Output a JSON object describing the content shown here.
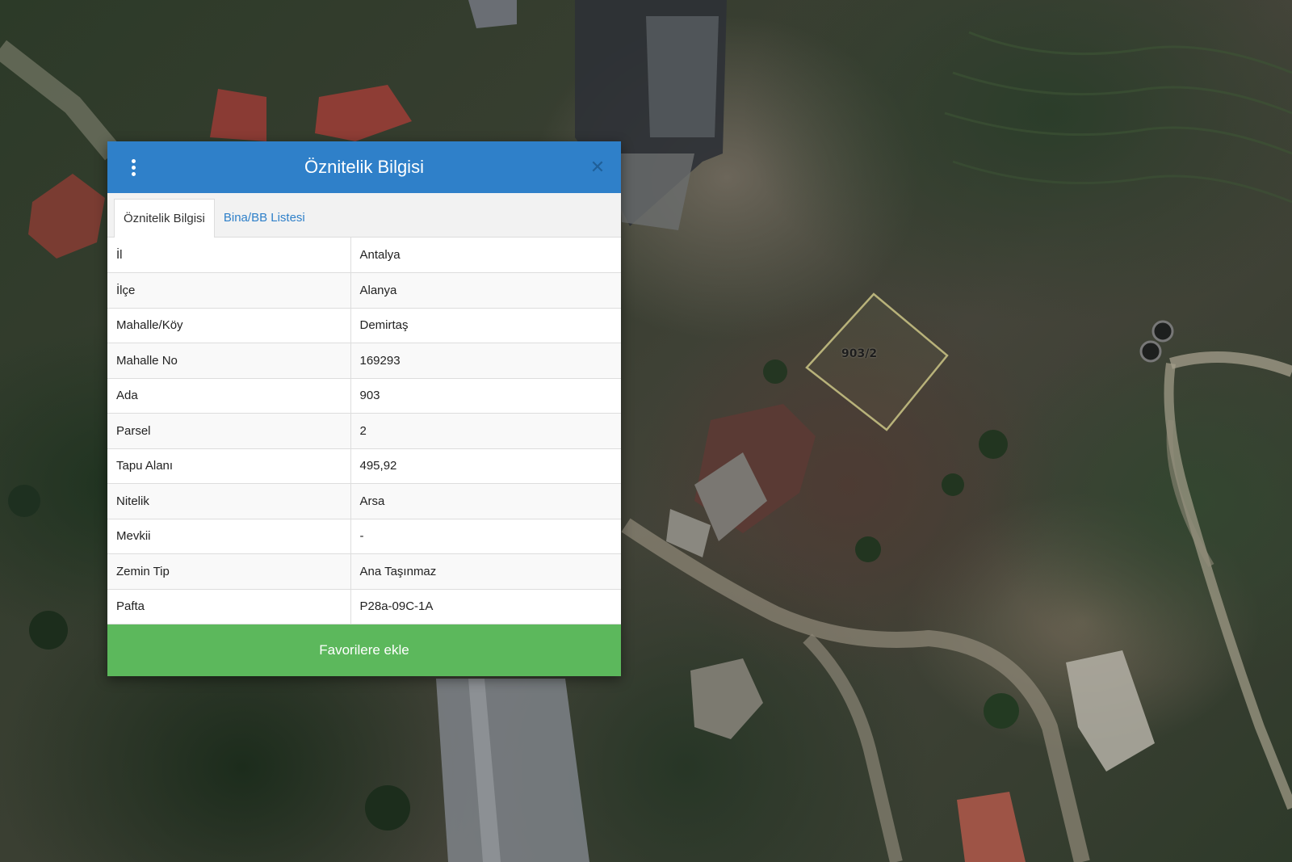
{
  "map": {
    "parcel_label": "903/2",
    "parcel_outline_color": "#b8b27a"
  },
  "panel": {
    "title": "Öznitelik Bilgisi",
    "menu_icon": "vertical-ellipsis-icon",
    "close_icon": "close-icon",
    "header_color": "#2f80c9",
    "tabs": [
      {
        "label": "Öznitelik Bilgisi",
        "active": true
      },
      {
        "label": "Bina/BB Listesi",
        "active": false
      }
    ],
    "rows": [
      {
        "key": "İl",
        "value": "Antalya"
      },
      {
        "key": "İlçe",
        "value": "Alanya"
      },
      {
        "key": "Mahalle/Köy",
        "value": "Demirtaş"
      },
      {
        "key": "Mahalle No",
        "value": "169293"
      },
      {
        "key": "Ada",
        "value": "903"
      },
      {
        "key": "Parsel",
        "value": "2"
      },
      {
        "key": "Tapu Alanı",
        "value": "495,92"
      },
      {
        "key": "Nitelik",
        "value": "Arsa"
      },
      {
        "key": "Mevkii",
        "value": "-"
      },
      {
        "key": "Zemin Tip",
        "value": "Ana Taşınmaz"
      },
      {
        "key": "Pafta",
        "value": "P28a-09C-1A"
      }
    ],
    "favorite_button": "Favorilere ekle",
    "favorite_color": "#5cb85c"
  }
}
